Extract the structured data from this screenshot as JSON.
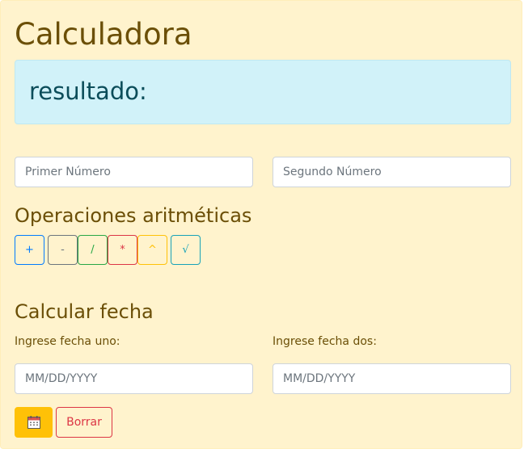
{
  "app": {
    "title": "Calculadora",
    "result_label": "resultado:"
  },
  "inputs": {
    "first_number_placeholder": "Primer Número",
    "second_number_placeholder": "Segundo Número"
  },
  "operations": {
    "title": "Operaciones aritméticas",
    "buttons": [
      {
        "label": "+",
        "color": "#007bff"
      },
      {
        "label": "-",
        "color": "#6c757d"
      },
      {
        "label": "/",
        "color": "#28a745"
      },
      {
        "label": "*",
        "color": "#dc3545"
      },
      {
        "label": "^",
        "color": "#ffc107"
      },
      {
        "label": "√",
        "color": "#17a2b8"
      }
    ]
  },
  "dates": {
    "title": "Calcular fecha",
    "date_one_label": "Ingrese fecha uno:",
    "date_two_label": "Ingrese fecha dos:",
    "date_one_placeholder": "MM/DD/YYYY",
    "date_two_placeholder": "MM/DD/YYYY",
    "calculate_icon": "calendar-icon",
    "clear_label": "Borrar"
  },
  "colors": {
    "card_bg": "#fff3cd",
    "heading": "#6b4f07",
    "result_bg": "#d1f2f9",
    "result_text": "#0b4d5a"
  }
}
